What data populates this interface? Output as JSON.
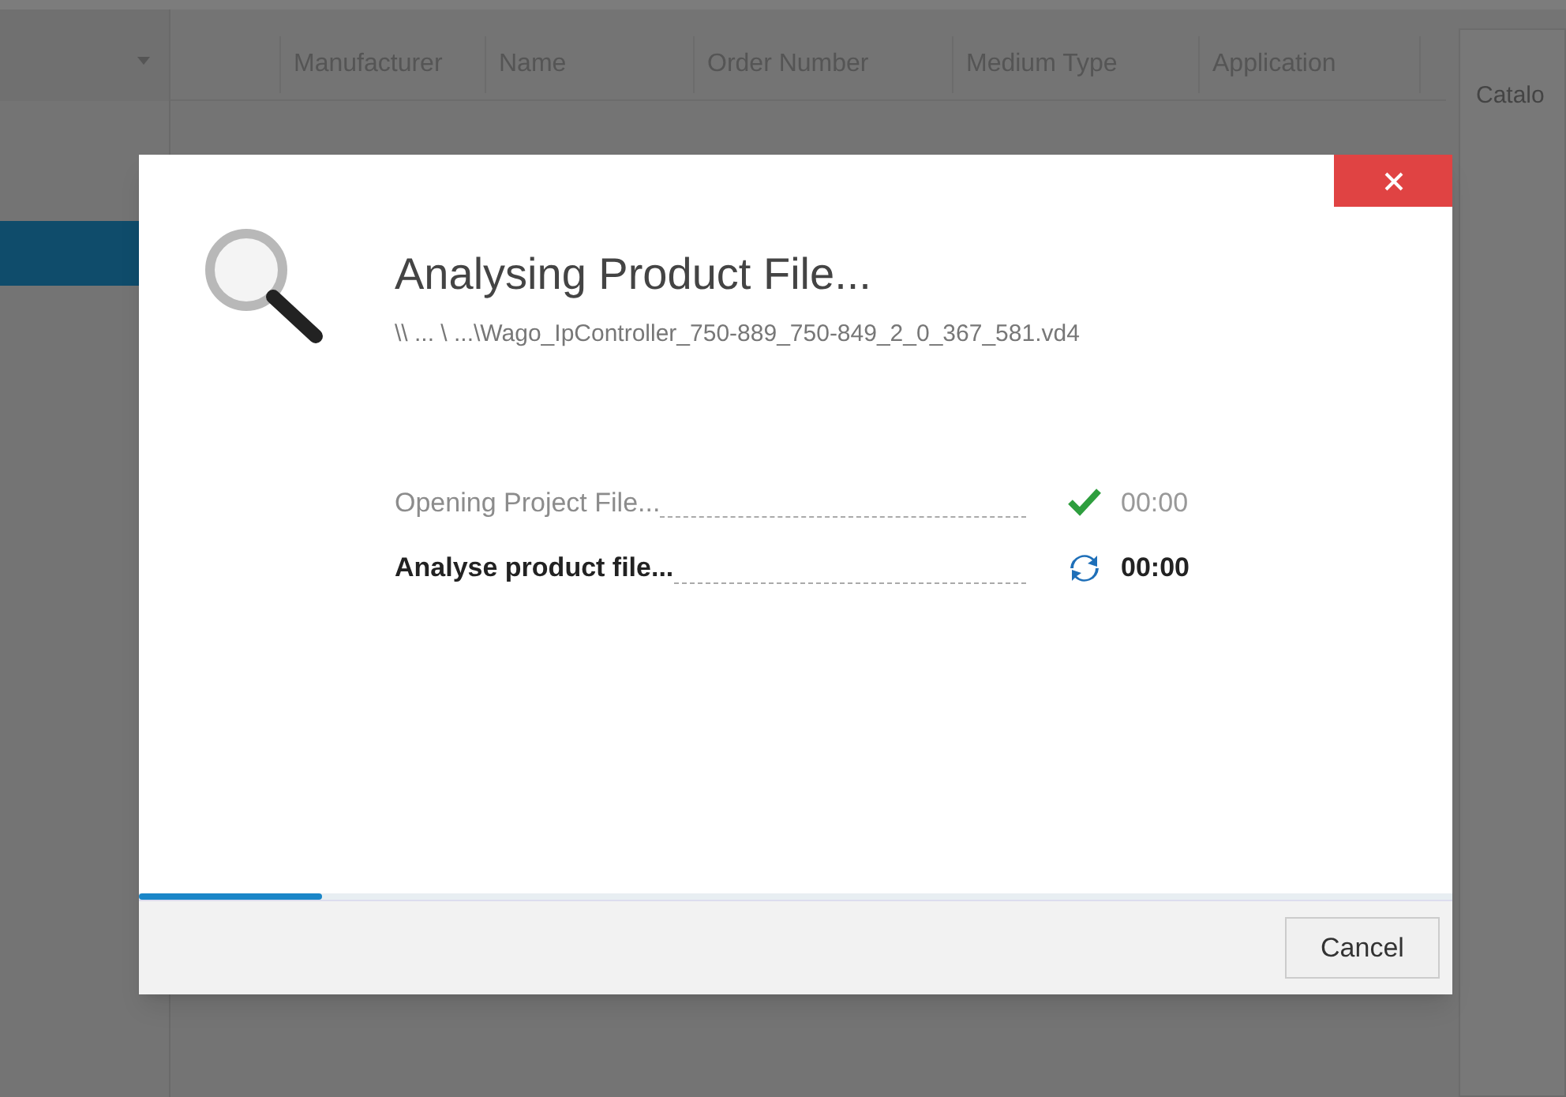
{
  "background": {
    "columns": [
      "Manufacturer",
      "Name",
      "Order Number",
      "Medium Type",
      "Application"
    ],
    "side_tab": "Catalo"
  },
  "dialog": {
    "title": "Analysing Product File...",
    "path": "\\\\ ... \\ ...\\Wago_IpController_750-889_750-849_2_0_367_581.vd4",
    "steps": [
      {
        "kind": "done",
        "label": "Opening Project File...",
        "time": "00:00"
      },
      {
        "kind": "running",
        "label": "Analyse product file...",
        "time": "00:00"
      }
    ],
    "progress": {
      "level": 0.14
    },
    "buttons": [
      "Cancel"
    ]
  }
}
